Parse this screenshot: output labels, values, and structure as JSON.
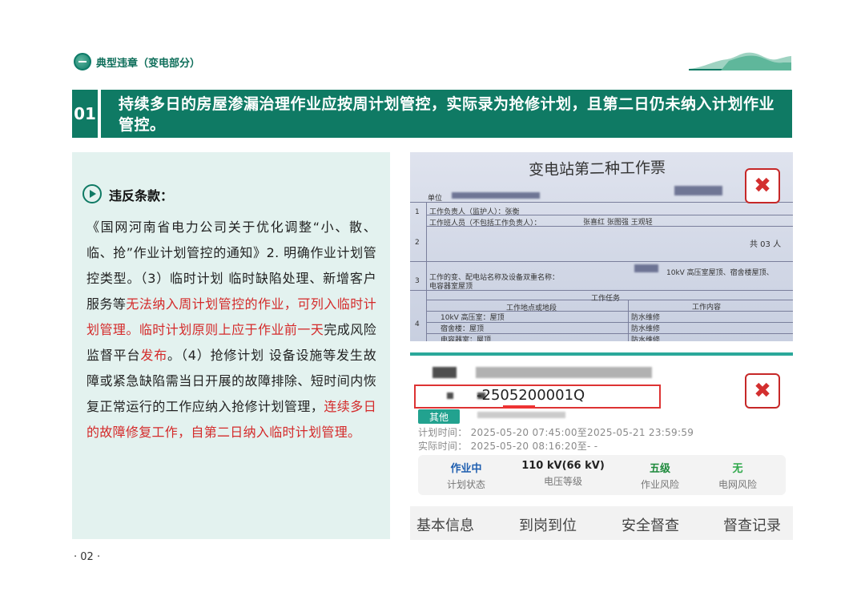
{
  "header": {
    "title": "典型违章（变电部分）"
  },
  "banner": {
    "number": "01",
    "text": "持续多日的房屋渗漏治理作业应按周计划管控，实际录为抢修计划，且第二日仍未纳入计划作业管控。"
  },
  "left": {
    "section_title": "违反条款：",
    "p1": "《国网河南省电力公司关于优化调整“小、散、临、抢”作业计划管控的通知》2. 明确作业计划管控类型。（3）临时计划 临时缺陷处理、新增客户服务等",
    "p1_red": "无法纳入周计划管控的作业，可列入临时计划管理。临时计划原则上应于作业前一天",
    "p2": "完成风险监督平台",
    "p2_red": "发布",
    "p3": "。（4）抢修计划 设备设施等发生故障或紧急缺陷需当日开展的故障排除、短时间内恢复正常运行的工作应纳入抢修计划管理，",
    "p3_red": "连续多日的故障修复工作，自第二日纳入临时计划管理。"
  },
  "ticket": {
    "title": "变电站第二种工作票",
    "unit_label": "单位",
    "row1": "工作负责人（监护人）：张衡",
    "row1b": "工作班人员（不包括工作负责人）：",
    "row1c": "张喜红 张图强 王观轻",
    "row2_count": "共 03 人",
    "row3_label": "工作的变、配电站名称及设备双重名称：",
    "row3_val": "10kV 高压室屋顶、宿舍楼屋顶、",
    "row3_val2": "电容器室屋顶",
    "task_header": "工作任务",
    "col_a": "工作地点或地段",
    "col_b": "工作内容",
    "r_a1": "10kV 高压室：屋顶",
    "r_b1": "防水维修",
    "r_a2": "宿舍楼：屋顶",
    "r_b2": "防水维修",
    "r_a3": "电容器室：屋顶",
    "r_b3": "防水维修",
    "nums": [
      "1",
      "2",
      "3",
      "4"
    ]
  },
  "app": {
    "code": "-2505200001Q",
    "tag": "其他",
    "plan_time": "计划时间：  2025-05-20 07:45:00至2025-05-21 23:59:59",
    "actual_time": "实际时间：  2025-05-20 08:16:20至- -",
    "stats": [
      {
        "value": "作业中",
        "label": "计划状态",
        "color": "#1f5fb0"
      },
      {
        "value": "110 kV(66 kV)",
        "label": "电压等级",
        "color": "#222222"
      },
      {
        "value": "五级",
        "label": "作业风险",
        "color": "#1e8a3c"
      },
      {
        "value": "无",
        "label": "电网风险",
        "color": "#2fa84a"
      }
    ],
    "tabs": [
      "基本信息",
      "到岗到位",
      "安全督查",
      "督查记录"
    ]
  },
  "page_number": "· 02 ·",
  "colors": {
    "accent": "#0f7a64",
    "panel": "#e3f2ef",
    "warn": "#d42a2a"
  }
}
